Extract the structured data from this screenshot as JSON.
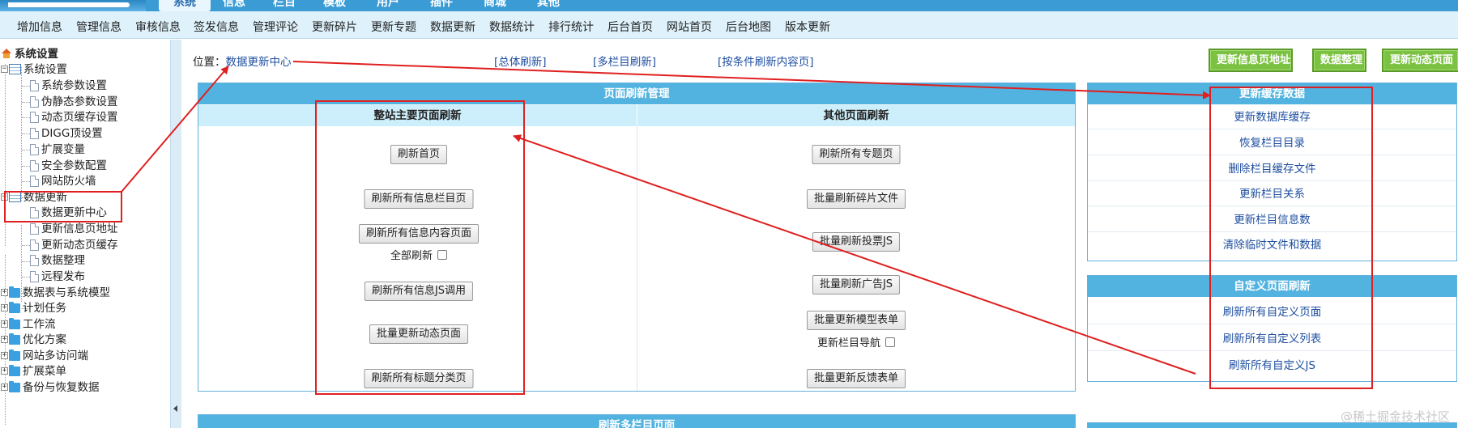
{
  "top_tabs": [
    "系统",
    "信息",
    "栏目",
    "模板",
    "用户",
    "插件",
    "商城",
    "其他"
  ],
  "subnav": [
    "增加信息",
    "管理信息",
    "审核信息",
    "签发信息",
    "管理评论",
    "更新碎片",
    "更新专题",
    "数据更新",
    "数据统计",
    "排行统计",
    "后台首页",
    "网站首页",
    "后台地图",
    "版本更新"
  ],
  "tree": {
    "root": "系统设置",
    "group1": "系统设置",
    "group1_items": [
      "系统参数设置",
      "伪静态参数设置",
      "动态页缓存设置",
      "DIGG顶设置",
      "扩展变量",
      "安全参数配置",
      "网站防火墙"
    ],
    "group2": "数据更新",
    "group2_items": [
      "数据更新中心",
      "更新信息页地址",
      "更新动态页缓存",
      "数据整理",
      "远程发布"
    ],
    "folders": [
      "数据表与系统模型",
      "计划任务",
      "工作流",
      "优化方案",
      "网站多访问端",
      "扩展菜单",
      "备份与恢复数据"
    ]
  },
  "location": {
    "label": "位置：",
    "current": "数据更新中心"
  },
  "links": [
    "[总体刷新]",
    "[多栏目刷新]",
    "[按条件刷新内容页]"
  ],
  "top_buttons": [
    "更新信息页地址",
    "数据整理",
    "更新动态页面"
  ],
  "main_panel": {
    "title": "页面刷新管理",
    "left_title": "整站主要页面刷新",
    "right_title": "其他页面刷新",
    "left_buttons": [
      "刷新首页",
      "刷新所有信息栏目页",
      "刷新所有信息内容页面",
      "刷新所有信息JS调用",
      "批量更新动态页面",
      "刷新所有标题分类页"
    ],
    "left_checkbox": "全部刷新",
    "right_buttons": [
      "刷新所有专题页",
      "批量刷新碎片文件",
      "批量刷新投票JS",
      "批量刷新广告JS",
      "批量更新模型表单",
      "批量更新反馈表单"
    ],
    "right_checkbox": "更新栏目导航"
  },
  "cache_panel": {
    "title": "更新缓存数据",
    "items": [
      "更新数据库缓存",
      "恢复栏目目录",
      "删除栏目缓存文件",
      "更新栏目关系",
      "更新栏目信息数",
      "清除临时文件和数据"
    ]
  },
  "custom_panel": {
    "title": "自定义页面刷新",
    "items": [
      "刷新所有自定义页面",
      "刷新所有自定义列表",
      "刷新所有自定义JS"
    ]
  },
  "bottom_panel_title": "刷新多栏目页面",
  "watermark": "@稀土掘金技术社区",
  "colors": {
    "annotation": "#e02020",
    "panel_header": "#52b3e0",
    "green_button": "#7cc242"
  }
}
